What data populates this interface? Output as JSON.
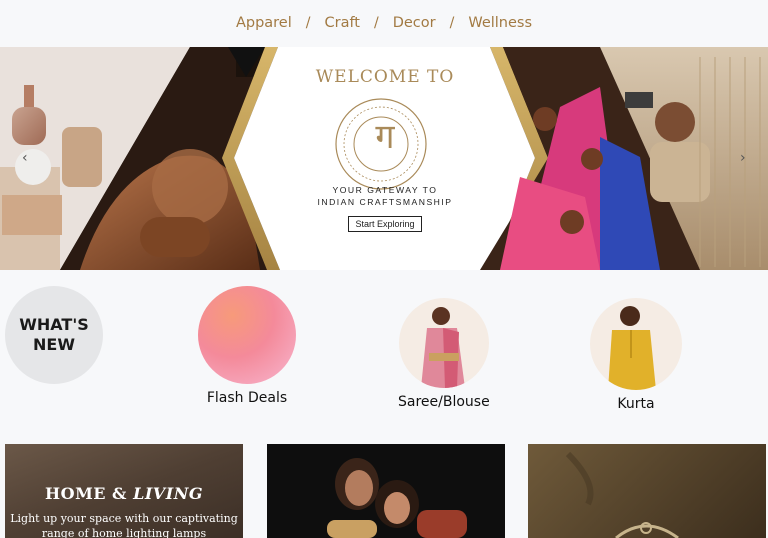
{
  "nav": {
    "items": [
      "Apparel",
      "Craft",
      "Decor",
      "Wellness"
    ],
    "separator": "/"
  },
  "hero": {
    "welcome": "WELCOME TO",
    "logo_glyph": "ग",
    "tagline_line1": "YOUR GATEWAY TO",
    "tagline_line2": "INDIAN CRAFTSMANSHIP",
    "cta": "Start Exploring",
    "prev_arrow": "‹",
    "next_arrow": "›"
  },
  "categories": {
    "whats_new_line1": "WHAT'S",
    "whats_new_line2": "NEW",
    "flash": "Flash Deals",
    "saree": "Saree/Blouse",
    "kurta": "Kurta"
  },
  "cards": {
    "home_title_a": "HOME & ",
    "home_title_b": "LIVING",
    "home_sub_line1": "Light up your space with our captivating",
    "home_sub_line2": "range of home lighting lamps"
  },
  "colors": {
    "nav_text": "#a27a43",
    "gold": "#c9a55a",
    "page_bg": "#f7f8fa"
  }
}
